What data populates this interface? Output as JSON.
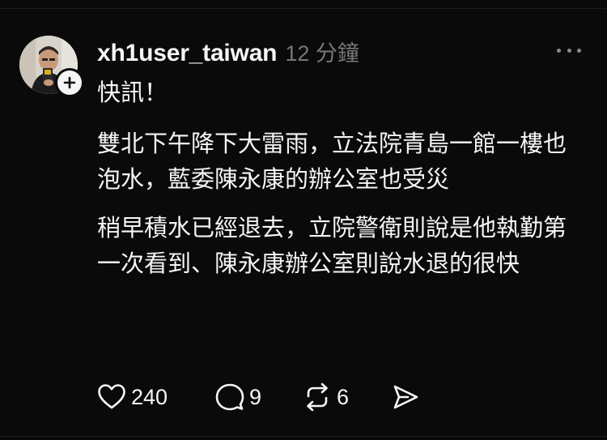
{
  "post": {
    "username": "xh1user_taiwan",
    "timestamp": "12 分鐘",
    "paragraphs": [
      "快訊！",
      "雙北下午降下大雷雨，立法院青島一館一樓也泡水，藍委陳永康的辦公室也受災",
      "稍早積水已經退去，立院警衛則說是他執勤第一次看到、陳永康辦公室則說水退的很快"
    ]
  },
  "actions": {
    "likes": "240",
    "replies": "9",
    "reposts": "6"
  },
  "icons": {
    "more": "more-horizontal-icon",
    "like": "heart-icon",
    "reply": "comment-icon",
    "repost": "repost-icon",
    "share": "send-icon",
    "follow": "plus-icon"
  },
  "colors": {
    "background": "#0a0a0a",
    "text": "#f3f5f7",
    "secondary": "#777777"
  }
}
